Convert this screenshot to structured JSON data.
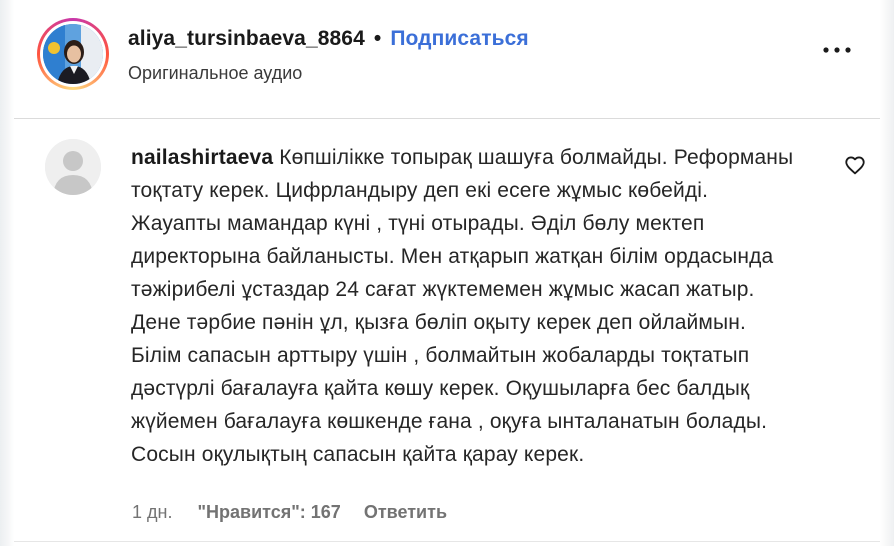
{
  "post_header": {
    "username": "aliya_tursinbaeva_8864",
    "separator": "•",
    "follow_label": "Подписаться",
    "audio_label": "Оригинальное аудио",
    "more_icon": "more-horizontal-icon"
  },
  "comment": {
    "username": "nailashirtaeva",
    "text": "Көпшілікке топырақ шашуға болмайды. Реформаны тоқтату керек. Цифрландыру деп екі есеге жұмыс көбейді. Жауапты мамандар күні , түні отырады. Әділ бөлу мектеп директорына байланысты. Мен атқарып жатқан білім ордасында тәжірибелі ұстаздар 24 сағат жүктемемен жұмыс жасап жатыр. Дене тәрбие пәнін ұл, қызға бөліп оқыту керек деп ойлаймын. Білім сапасын арттыру үшін , болмайтын жобаларды тоқтатып дәстүрлі бағалауға қайта көшу керек. Оқушыларға бес балдық жүйемен бағалауға көшкенде ғана , оқуға ынталанатын болады. Сосын оқулықтың сапасын қайта қарау керек.",
    "time": "1 дн.",
    "likes_label": "\"Нравится\": 167",
    "reply_label": "Ответить",
    "like_icon": "heart-outline-icon"
  }
}
